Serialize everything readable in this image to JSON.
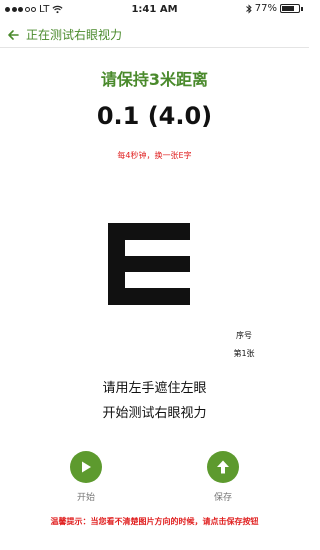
{
  "status_bar": {
    "carrier": "LT",
    "time": "1:41 AM",
    "battery_text": "77%",
    "battery_level": 0.77
  },
  "header": {
    "title": "正在测试右眼视力"
  },
  "test": {
    "instruction": "请保持3米距离",
    "acuity": "0.1 (4.0)",
    "interval_note": "每4秒钟，换一张E字",
    "optotype": "E",
    "optotype_direction": "right",
    "sequence_label": "序号",
    "sequence_value": "第1张",
    "prompt_line1": "请用左手遮住左眼",
    "prompt_line2": "开始测试右眼视力"
  },
  "actions": {
    "start_label": "开始",
    "save_label": "保存"
  },
  "tip": "温馨提示：当您看不清楚图片方向的时候，请点击保存按钮",
  "colors": {
    "accent": "#5d9a2e",
    "title_green": "#4a8a2c",
    "warning_red": "#e02020"
  }
}
